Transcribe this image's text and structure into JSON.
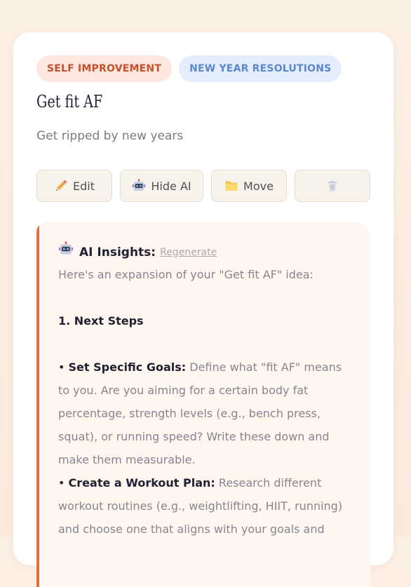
{
  "tags": [
    "SELF IMPROVEMENT",
    "NEW YEAR RESOLUTIONS"
  ],
  "idea": {
    "title": "Get fit AF",
    "description": "Get ripped by new years"
  },
  "actions": {
    "edit": "Edit",
    "hide_ai": "Hide AI",
    "move": "Move",
    "delete_icon": "trash-icon"
  },
  "insights": {
    "heading": "AI Insights:",
    "regenerate": "Regenerate",
    "intro": "Here's an expansion of your \"Get fit AF\" idea:",
    "section_1": "1. Next Steps",
    "bullets": [
      {
        "bold": "Set Specific Goals:",
        "text": " Define what \"fit AF\" means to you. Are you aiming for a certain body fat percentage, strength levels (e.g., bench press, squat), or running speed? Write these down and make them measurable."
      },
      {
        "bold": "Create a Workout Plan:",
        "text": " Research different workout routines (e.g., weightlifting, HIIT, running) and choose one that aligns with your goals and"
      }
    ]
  },
  "colors": {
    "accent": "#e2703d",
    "tag_orange_text": "#c2512f",
    "tag_blue_text": "#5d87cd"
  }
}
